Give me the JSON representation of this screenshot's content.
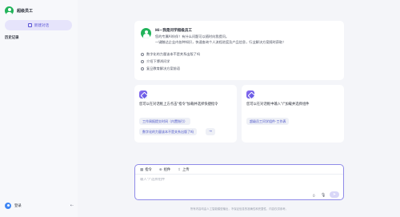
{
  "sidebar": {
    "brand_name": "超级员工",
    "new_chat_label": "新建对话",
    "history_title": "历史记录",
    "user_name": "登录",
    "collapse_icon": "collapse-icon"
  },
  "welcome": {
    "greeting": "Hi~我是问学超级员工",
    "line1": "您的专属AI伙伴！有什么问题可以随时向我提问。",
    "line2": "一键触达企业内各种知识，快速查询个人流程进度及产品信息，行业解决方案随时获取！",
    "suggestions": [
      "数字化的力量该本不是关系出版了吗",
      "介绍下博鸿问学",
      "复旦教育解决方案前语"
    ]
  },
  "panels": {
    "left": {
      "title": "您可以在对话框上方点击\"指令\"加载并选择快捷指令",
      "chip1": "工作周报提交时间（内置指引）",
      "chip2": "数字化的力量该本不是关系出版了吗",
      "arrow": "→"
    },
    "right": {
      "title": "您可以在对话框中输入\"/\"加载并选择组件",
      "chip1": "超级员工问学组件-工作表",
      "arrow": "→"
    }
  },
  "composer": {
    "tools": [
      {
        "icon": "▦",
        "label": "指令"
      },
      {
        "icon": "⊕",
        "label": "组件"
      },
      {
        "icon": "⇪",
        "label": "上传"
      }
    ],
    "placeholder": "输入\"/\"选择组件",
    "char_count": "0",
    "mic_icon": "microphone-icon",
    "send_icon": "send-icon"
  },
  "footnote": "所有内容均由人工智能模型输出，不保证信息的准确性和完整性，内容仅供参考。",
  "colors": {
    "accent": "#5b55d6",
    "brand_green": "#21b35a",
    "composer_border": "#8f8be8"
  }
}
